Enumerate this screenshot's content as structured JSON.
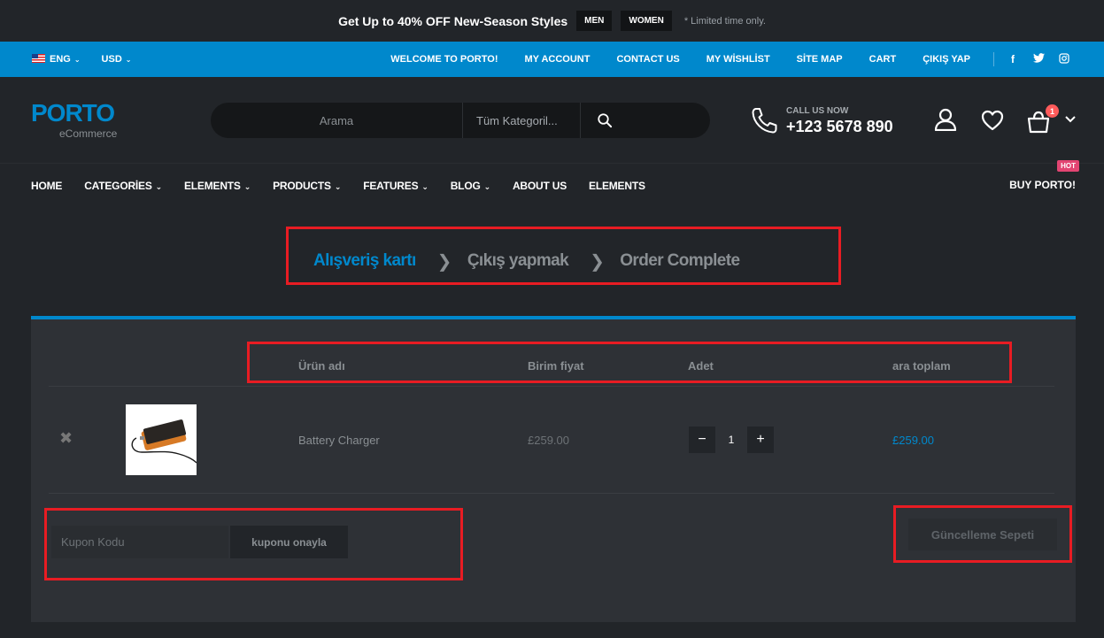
{
  "promo": {
    "text_before": "Get Up to",
    "highlight": "40% OFF",
    "text_after": "New-Season Styles",
    "tags": [
      "MEN",
      "WOMEN"
    ],
    "note": "* Limited time only."
  },
  "topbar": {
    "language": "ENG",
    "currency": "USD",
    "links": [
      "WELCOME TO PORTO!",
      "MY ACCOUNT",
      "CONTACT US",
      "MY WİSHLİST",
      "SİTE MAP",
      "CART",
      "ÇIKIŞ YAP"
    ],
    "social": [
      "facebook-icon",
      "twitter-icon",
      "instagram-icon"
    ],
    "bg_color": "#0088cc"
  },
  "header": {
    "logo": "PORTO",
    "logo_sub": "eCommerce",
    "search_placeholder": "Arama",
    "search_category": "Tüm Kategoril...",
    "call_label": "CALL US NOW",
    "phone": "+123 5678 890",
    "cart_count": "1"
  },
  "nav": {
    "items": [
      {
        "label": "HOME",
        "dropdown": false
      },
      {
        "label": "CATEGORİES",
        "dropdown": true
      },
      {
        "label": "ELEMENTS",
        "dropdown": true
      },
      {
        "label": "PRODUCTS",
        "dropdown": true
      },
      {
        "label": "FEATURES",
        "dropdown": true
      },
      {
        "label": "BLOG",
        "dropdown": true
      },
      {
        "label": "ABOUT US",
        "dropdown": false
      },
      {
        "label": "ELEMENTS",
        "dropdown": false
      }
    ],
    "buy": "BUY PORTO!",
    "hot": "HOT"
  },
  "steps": [
    "Alışveriş kartı",
    "Çıkış yapmak",
    "Order Complete"
  ],
  "table": {
    "headers": [
      "Ürün adı",
      "Birim fiyat",
      "Adet",
      "ara toplam"
    ],
    "row": {
      "name": "Battery Charger",
      "unit_price": "£259.00",
      "quantity": "1",
      "subtotal": "£259.00"
    }
  },
  "coupon": {
    "placeholder": "Kupon Kodu",
    "apply_label": "kuponu onayla"
  },
  "update_label": "Güncelleme Sepeti",
  "colors": {
    "accent": "#0088cc",
    "annotation": "#e81c23",
    "background": "#222529"
  }
}
